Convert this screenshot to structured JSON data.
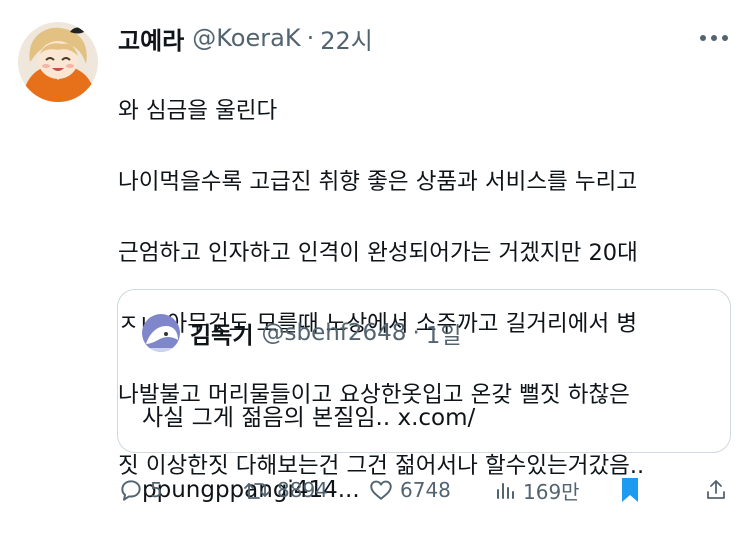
{
  "tweet": {
    "author": {
      "display_name": "고예라",
      "handle": "@KoeraK",
      "separator": "·",
      "time": "22시"
    },
    "text_lines": [
      "와 심금을 울린다",
      "나이먹을수록 고급진 취향 좋은 상품과 서비스를 누리고",
      "근엄하고 인자하고 인격이 완성되어가는 거겠지만 20대",
      "ㅈㄴ 아무것도 모를때 노상에서 소주까고 길거리에서 병",
      "나발불고 머리물들이고 요상한옷입고 온갖 뻘짓 하찮은",
      "짓 이상한짓 다해보는건 그건 젊어서나 할수있는거갔음.."
    ],
    "quote": {
      "display_name": "김독기",
      "handle": "@sbehf2648",
      "separator": "·",
      "time": "1일",
      "text_lines": [
        "사실 그게 젊음의 본질임.. x.com/",
        "ppungppangi414..."
      ]
    },
    "actions": {
      "replies": "5",
      "retweets": "8894",
      "likes": "6748",
      "views": "169만"
    }
  },
  "icons": {
    "more": "more-icon",
    "reply": "reply-icon",
    "retweet": "retweet-icon",
    "like": "heart-icon",
    "views": "views-icon",
    "bookmark": "bookmark-icon",
    "share": "share-icon"
  },
  "colors": {
    "text_primary": "#0f1419",
    "text_secondary": "#536471",
    "border": "#cfd9de",
    "accent_blue": "#1d9bf0"
  }
}
